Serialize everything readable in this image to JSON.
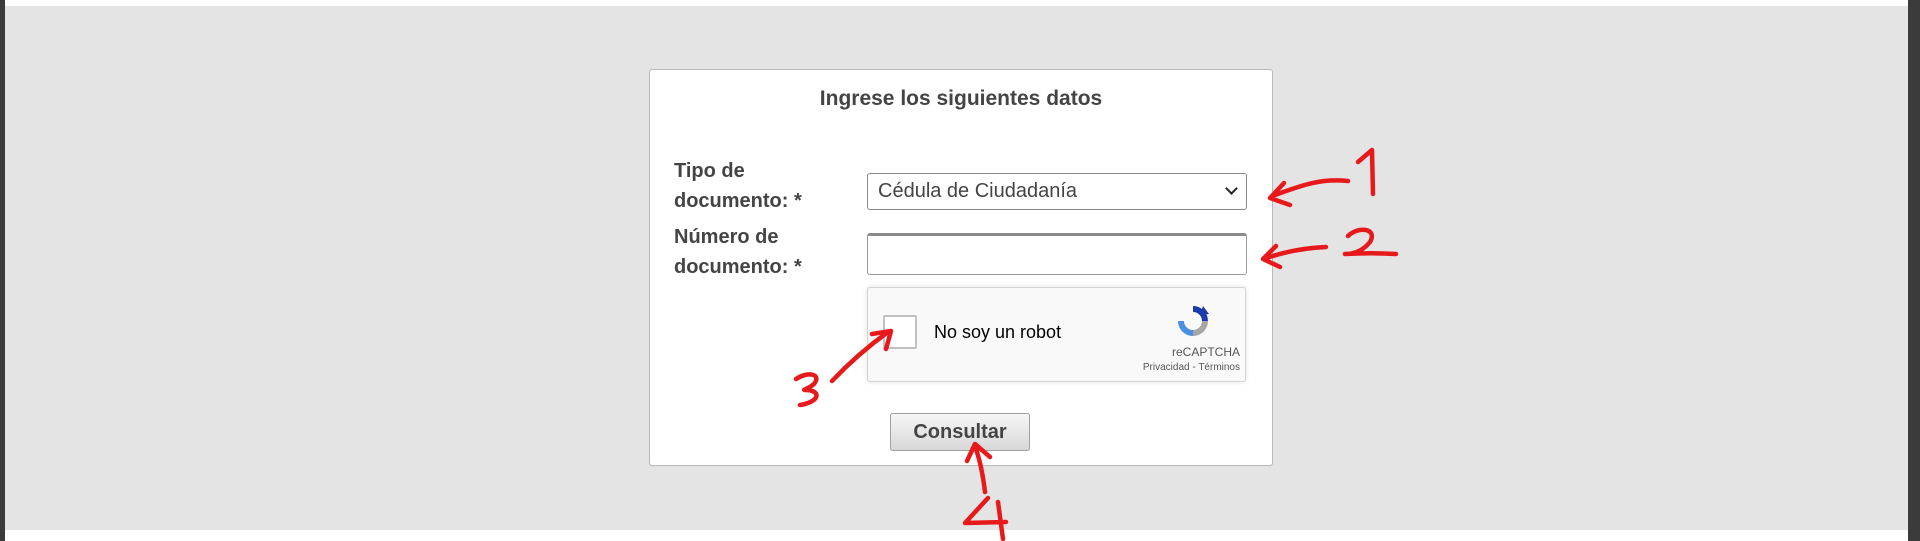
{
  "form": {
    "title": "Ingrese los siguientes datos",
    "document_type": {
      "label_line1": "Tipo de",
      "label_line2": "documento: *",
      "selected_value": "Cédula de Ciudadanía"
    },
    "document_number": {
      "label_line1": "Número de",
      "label_line2": "documento: *",
      "value": ""
    },
    "recaptcha": {
      "checkbox_label": "No soy un robot",
      "brand": "reCAPTCHA",
      "privacy_link": "Privacidad",
      "separator": "-",
      "terms_link": "Términos",
      "icon": "recaptcha-logo-icon"
    },
    "submit_label": "Consultar"
  },
  "annotations": {
    "color": "#e8191b",
    "items": [
      {
        "number": "1",
        "target": "document-type-select"
      },
      {
        "number": "2",
        "target": "document-number-input"
      },
      {
        "number": "3",
        "target": "recaptcha-checkbox"
      },
      {
        "number": "4",
        "target": "consultar-button"
      }
    ]
  },
  "colors": {
    "page_background": "#e4e4e4",
    "panel_background": "#ffffff",
    "text": "#444444"
  }
}
